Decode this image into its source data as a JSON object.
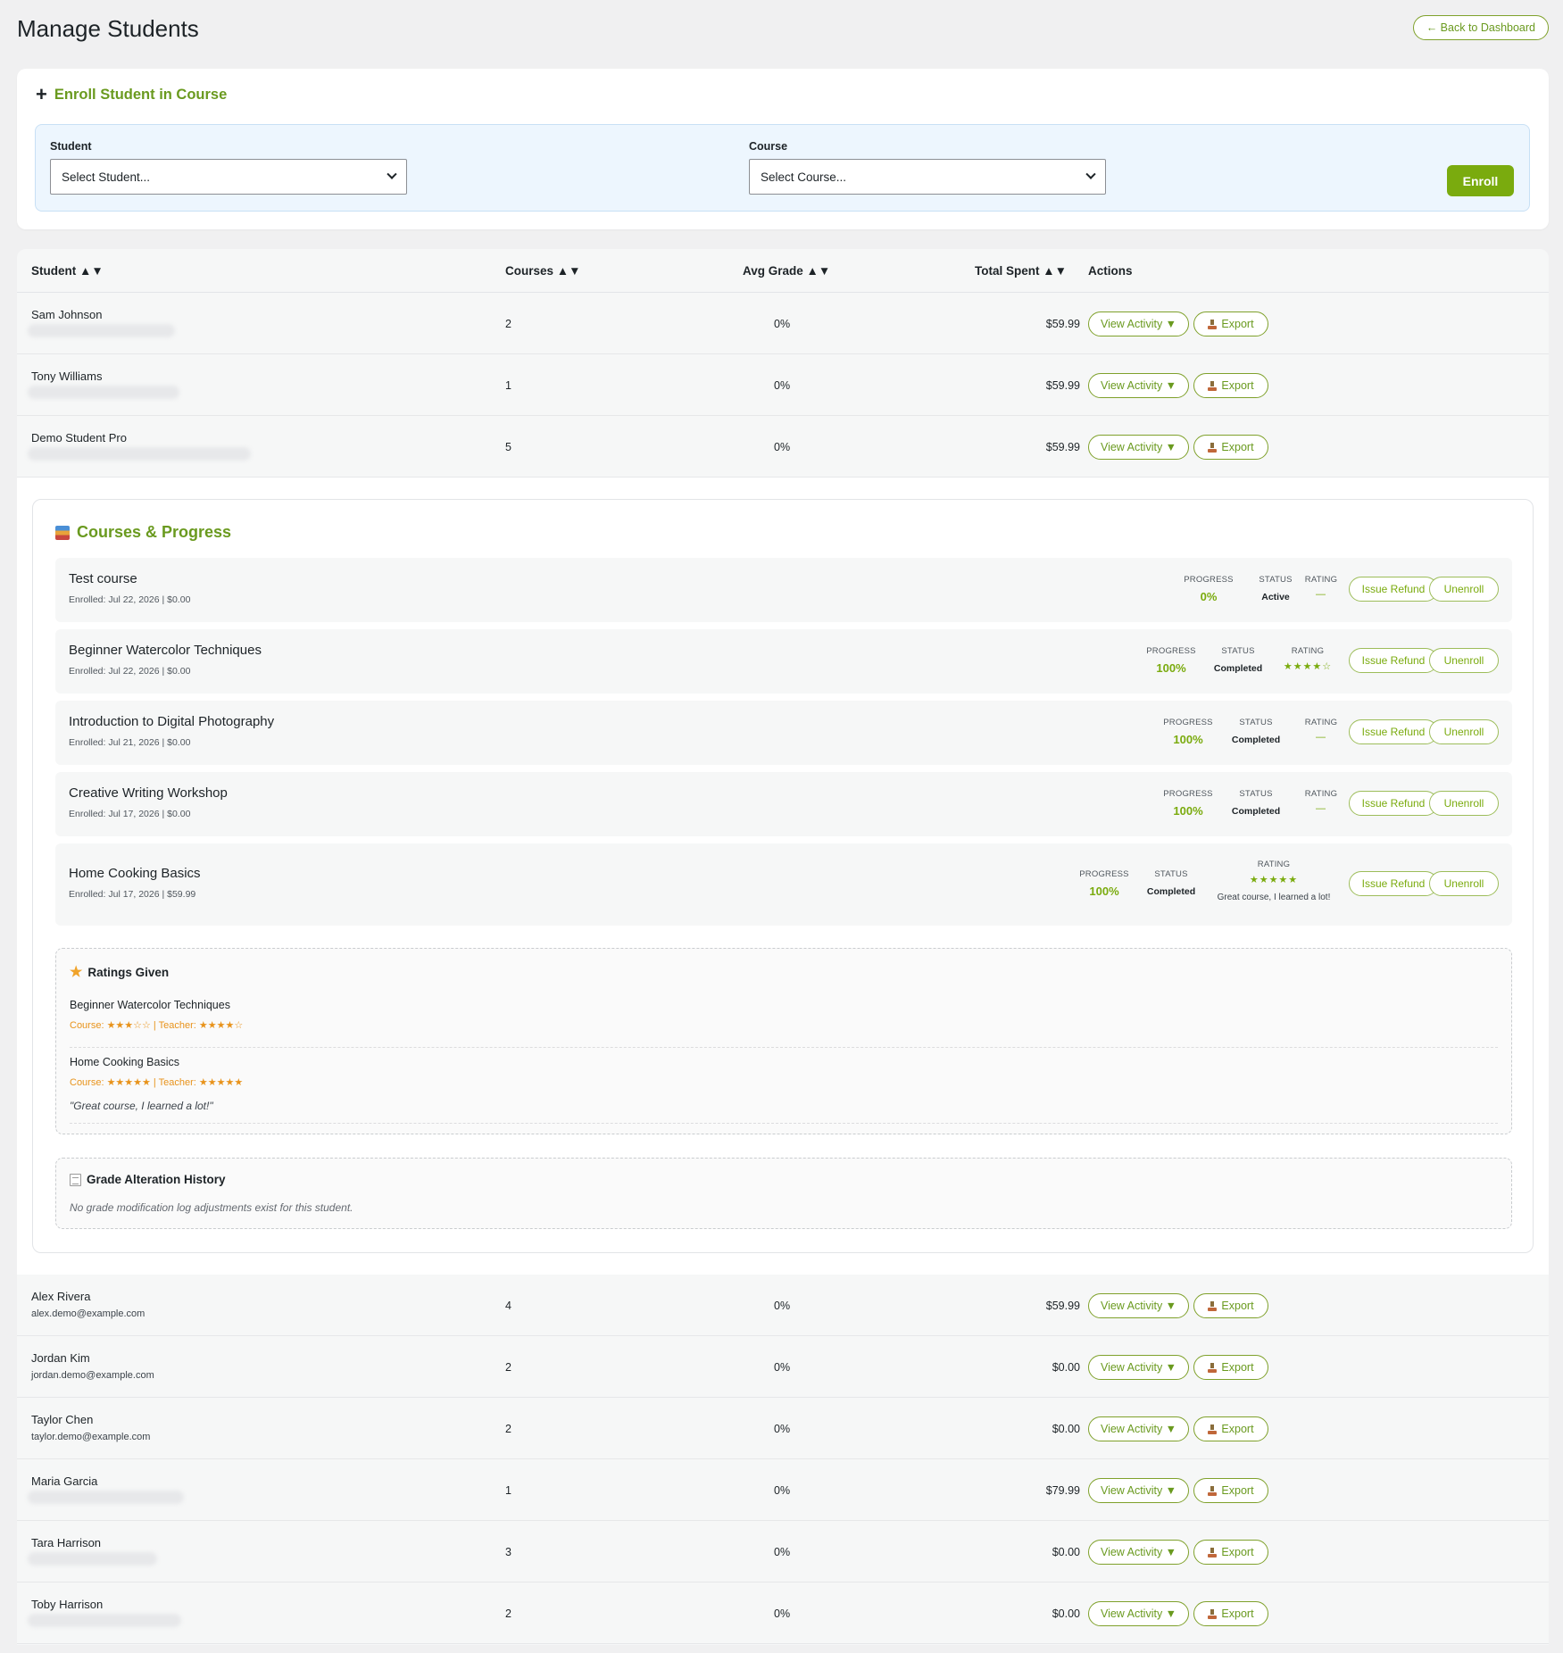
{
  "page": {
    "title": "Manage Students",
    "back_label": "← Back to Dashboard"
  },
  "enroll": {
    "title": "Enroll Student in Course",
    "student_label": "Student",
    "student_value": "Select Student...",
    "course_label": "Course",
    "course_value": "Select Course...",
    "button": "Enroll"
  },
  "table": {
    "headers": [
      "Student ▲▼",
      "Courses ▲▼",
      "Avg Grade ▲▼",
      "Total Spent ▲▼",
      "Actions"
    ],
    "view_label": "View Activity ▼",
    "export_label": "Export",
    "rows_top": [
      {
        "name": "Sam Johnson",
        "courses": "2",
        "grade": "0%",
        "spent": "$59.99"
      },
      {
        "name": "Tony Williams",
        "courses": "1",
        "grade": "0%",
        "spent": "$59.99"
      },
      {
        "name": "Demo Student Pro",
        "courses": "5",
        "grade": "0%",
        "spent": "$59.99"
      }
    ],
    "rows_bottom": [
      {
        "name": "Alex Rivera",
        "email": "alex.demo@example.com",
        "courses": "4",
        "grade": "0%",
        "spent": "$59.99"
      },
      {
        "name": "Jordan Kim",
        "email": "jordan.demo@example.com",
        "courses": "2",
        "grade": "0%",
        "spent": "$0.00"
      },
      {
        "name": "Taylor Chen",
        "email": "taylor.demo@example.com",
        "courses": "2",
        "grade": "0%",
        "spent": "$0.00"
      },
      {
        "name": "Maria Garcia",
        "courses": "1",
        "grade": "0%",
        "spent": "$79.99"
      },
      {
        "name": "Tara Harrison",
        "courses": "3",
        "grade": "0%",
        "spent": "$0.00"
      },
      {
        "name": "Toby Harrison",
        "courses": "2",
        "grade": "0%",
        "spent": "$0.00"
      }
    ]
  },
  "panel": {
    "title": "Courses & Progress",
    "labels": {
      "progress": "PROGRESS",
      "status": "STATUS",
      "rating": "RATING"
    },
    "refund_label": "Issue Refund",
    "unenroll_label": "Unenroll",
    "courses": [
      {
        "name": "Test course",
        "meta": "Enrolled: Jul 22, 2026 | $0.00",
        "progress": "0%",
        "status": "Active",
        "rating": "—"
      },
      {
        "name": "Beginner Watercolor Techniques",
        "meta": "Enrolled: Jul 22, 2026 | $0.00",
        "progress": "100%",
        "status": "Completed",
        "rating": "★★★★☆"
      },
      {
        "name": "Introduction to Digital Photography",
        "meta": "Enrolled: Jul 21, 2026 | $0.00",
        "progress": "100%",
        "status": "Completed",
        "rating": "—"
      },
      {
        "name": "Creative Writing Workshop",
        "meta": "Enrolled: Jul 17, 2026 | $0.00",
        "progress": "100%",
        "status": "Completed",
        "rating": "—"
      },
      {
        "name": "Home Cooking Basics",
        "meta": "Enrolled: Jul 17, 2026 | $59.99",
        "progress": "100%",
        "status": "Completed",
        "rating": "★★★★★",
        "comment": "Great course, I learned a lot!"
      }
    ],
    "ratings": {
      "title": "Ratings Given",
      "items": [
        {
          "course": "Beginner Watercolor Techniques",
          "line": "Course: ★★★☆☆ | Teacher: ★★★★☆"
        },
        {
          "course": "Home Cooking Basics",
          "line": "Course: ★★★★★ | Teacher: ★★★★★",
          "comment": "\"Great course, I learned a lot!\""
        }
      ]
    },
    "grade_history": {
      "title": "Grade Alteration History",
      "empty": "No grade modification log adjustments exist for this student."
    }
  }
}
